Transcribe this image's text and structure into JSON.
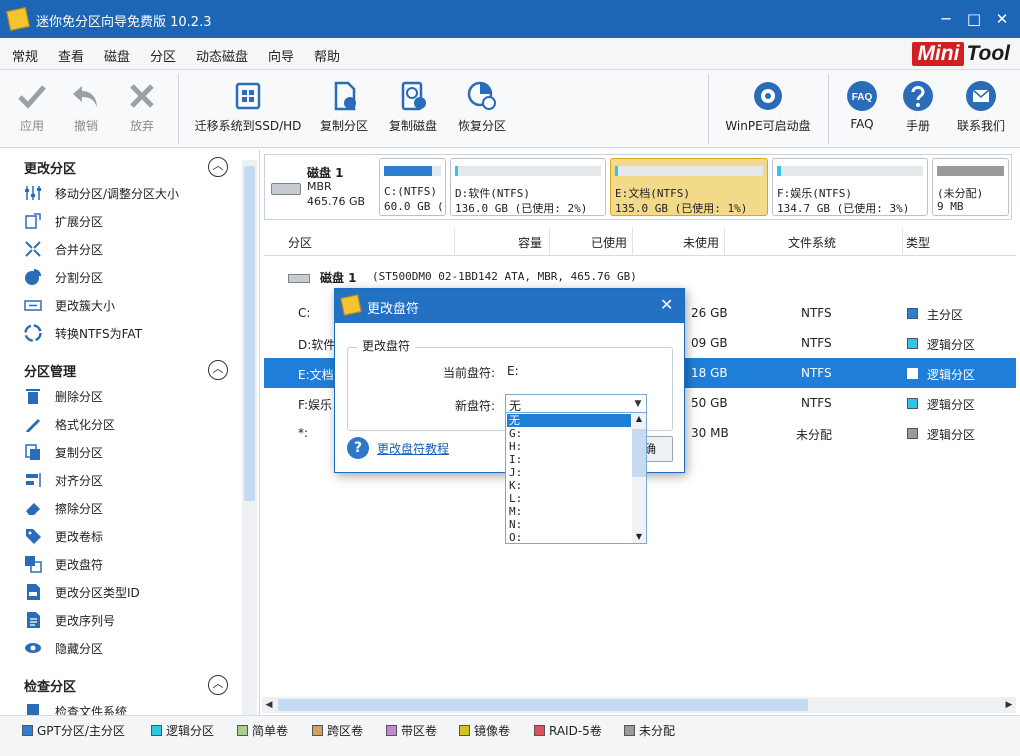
{
  "app": {
    "title": "迷你免分区向导免费版 10.2.3",
    "brand_mini": "Mini",
    "brand_tool": "Tool"
  },
  "window_controls": [
    "─",
    "□",
    "✕"
  ],
  "menu": [
    "常规",
    "查看",
    "磁盘",
    "分区",
    "动态磁盘",
    "向导",
    "帮助"
  ],
  "toolbar": {
    "apply": "应用",
    "undo": "撤销",
    "discard": "放弃",
    "migrate": "迁移系统到SSD/HD",
    "copy_partition": "复制分区",
    "copy_disk": "复制磁盘",
    "recover_partition": "恢复分区",
    "winpe": "WinPE可启动盘",
    "faq": "FAQ",
    "manual": "手册",
    "contact": "联系我们",
    "faq_icon_text": "FAQ"
  },
  "sidebar": {
    "section1": "更改分区",
    "section1_items": [
      "移动分区/调整分区大小",
      "扩展分区",
      "合并分区",
      "分割分区",
      "更改簇大小",
      "转换NTFS为FAT"
    ],
    "section2": "分区管理",
    "section2_items": [
      "删除分区",
      "格式化分区",
      "复制分区",
      "对齐分区",
      "擦除分区",
      "更改卷标",
      "更改盘符",
      "更改分区类型ID",
      "更改序列号",
      "隐藏分区"
    ],
    "section3": "检查分区",
    "section3_items": [
      "检查文件系统"
    ]
  },
  "diskmap": {
    "disk_name": "磁盘 1",
    "disk_type": "MBR",
    "disk_size": "465.76 GB",
    "partitions": [
      {
        "name": "C:(NTFS)",
        "size": "60.0 GB (",
        "bar_color": "#2f7fd0",
        "usage": 0.85
      },
      {
        "name": "D:软件(NTFS)",
        "size": "136.0 GB (已使用: 2%)",
        "bar_color": "#2fc6e6",
        "usage": 0.02
      },
      {
        "name": "E:文档(NTFS)",
        "size": "135.0 GB (已使用: 1%)",
        "bar_color": "#2fc6e6",
        "usage": 0.01,
        "selected": true
      },
      {
        "name": "F:娱乐(NTFS)",
        "size": "134.7 GB (已使用: 3%)",
        "bar_color": "#2fc6e6",
        "usage": 0.03
      },
      {
        "name": "(未分配)",
        "size": "9 MB",
        "bar_color": "#9a9a9a",
        "usage": 1
      }
    ]
  },
  "table": {
    "headers": [
      "分区",
      "容量",
      "已使用",
      "未使用",
      "文件系统",
      "类型"
    ],
    "disk_label": "磁盘 1",
    "disk_detail": "(ST500DM0 02-1BD142 ATA, MBR, 465.76 GB)",
    "rows": [
      {
        "partition": "C:",
        "unused": "26 GB",
        "fs": "NTFS",
        "type": "主分区",
        "type_color": "#2f7fd0"
      },
      {
        "partition": "D:软件",
        "unused": "09 GB",
        "fs": "NTFS",
        "type": "逻辑分区",
        "type_color": "#2fc6e6"
      },
      {
        "partition": "E:文档",
        "unused": "18 GB",
        "fs": "NTFS",
        "type": "逻辑分区",
        "type_color": "#ffffff",
        "selected": true
      },
      {
        "partition": "F:娱乐",
        "unused": "50 GB",
        "fs": "NTFS",
        "type": "逻辑分区",
        "type_color": "#2fc6e6"
      },
      {
        "partition": "*:",
        "unused": "30 MB",
        "fs": "未分配",
        "type": "逻辑分区",
        "type_color": "#9a9a9a"
      }
    ]
  },
  "legend": [
    {
      "label": "GPT分区/主分区",
      "color": "#2f7fd0"
    },
    {
      "label": "逻辑分区",
      "color": "#2fc6e6"
    },
    {
      "label": "简单卷",
      "color": "#a8d08d"
    },
    {
      "label": "跨区卷",
      "color": "#d4a15a"
    },
    {
      "label": "带区卷",
      "color": "#c586d6"
    },
    {
      "label": "镜像卷",
      "color": "#d6c21c"
    },
    {
      "label": "RAID-5卷",
      "color": "#e0525b"
    },
    {
      "label": "未分配",
      "color": "#9a9a9a"
    }
  ],
  "dialog": {
    "title": "更改盘符",
    "group_title": "更改盘符",
    "current_label": "当前盘符:",
    "current_value": "E:",
    "new_label": "新盘符:",
    "new_value": "无",
    "help_link": "更改盘符教程",
    "ok_button_partial": "确"
  },
  "dropdown_options": [
    "无",
    "G:",
    "H:",
    "I:",
    "J:",
    "K:",
    "L:",
    "M:",
    "N:",
    "O:"
  ]
}
